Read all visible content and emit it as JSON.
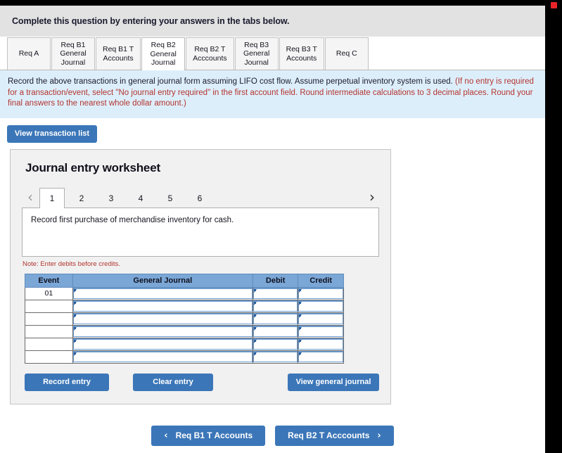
{
  "banner": {
    "text": "Complete this question by entering your answers in the tabs below."
  },
  "tabs": {
    "items": [
      {
        "name": "req-a",
        "lines": [
          "Req A"
        ],
        "active": false
      },
      {
        "name": "req-b1-gj",
        "lines": [
          "Req B1",
          "General",
          "Journal"
        ],
        "active": false
      },
      {
        "name": "req-b1-t",
        "lines": [
          "Req B1 T",
          "Accounts"
        ],
        "active": false
      },
      {
        "name": "req-b2-gj",
        "lines": [
          "Req B2",
          "General",
          "Journal"
        ],
        "active": true
      },
      {
        "name": "req-b2-t",
        "lines": [
          "Req B2 T",
          "Acccounts"
        ],
        "active": false
      },
      {
        "name": "req-b3-gj",
        "lines": [
          "Req B3",
          "General",
          "Journal"
        ],
        "active": false
      },
      {
        "name": "req-b3-t",
        "lines": [
          "Req B3 T",
          "Accounts"
        ],
        "active": false
      },
      {
        "name": "req-c",
        "lines": [
          "Req C"
        ],
        "active": false
      }
    ]
  },
  "instruction": {
    "black_part": "Record the above transactions in general journal form assuming LIFO cost flow. Assume perpetual inventory system is used. ",
    "red_part": "(If no entry is required for a transaction/event, select \"No journal entry required\" in the first account field. Round intermediate calculations to 3 decimal places. Round your final answers to the nearest whole dollar amount.)"
  },
  "view_transaction_list": {
    "label": "View transaction list"
  },
  "worksheet": {
    "title": "Journal entry worksheet",
    "pager": {
      "prev_icon": "chevron-left-icon",
      "next_icon": "chevron-right-icon",
      "pages": [
        "1",
        "2",
        "3",
        "4",
        "5",
        "6"
      ],
      "active_page": "1"
    },
    "description": "Record first purchase of merchandise inventory for cash.",
    "note": "Note: Enter debits before credits.",
    "table": {
      "headers": [
        "Event",
        "General Journal",
        "Debit",
        "Credit"
      ],
      "rows": [
        {
          "event": "01",
          "general_journal": "",
          "debit": "",
          "credit": ""
        },
        {
          "event": "",
          "general_journal": "",
          "debit": "",
          "credit": ""
        },
        {
          "event": "",
          "general_journal": "",
          "debit": "",
          "credit": ""
        },
        {
          "event": "",
          "general_journal": "",
          "debit": "",
          "credit": ""
        },
        {
          "event": "",
          "general_journal": "",
          "debit": "",
          "credit": ""
        },
        {
          "event": "",
          "general_journal": "",
          "debit": "",
          "credit": ""
        }
      ]
    },
    "actions": {
      "record_entry": "Record entry",
      "clear_entry": "Clear entry",
      "view_general_journal": "View general journal"
    }
  },
  "footer_nav": {
    "prev": {
      "label": "Req B1 T Accounts",
      "icon": "chevron-left-icon"
    },
    "next": {
      "label": "Req B2 T Acccounts",
      "icon": "chevron-right-icon"
    }
  },
  "colors": {
    "button_blue": "#3b76b8",
    "banner_gray": "#e2e2e2",
    "instruction_blue": "#ddeefb",
    "note_red": "#b3352e",
    "table_header_blue": "#7ba7d7",
    "panel_gray": "#f1f1f1"
  }
}
